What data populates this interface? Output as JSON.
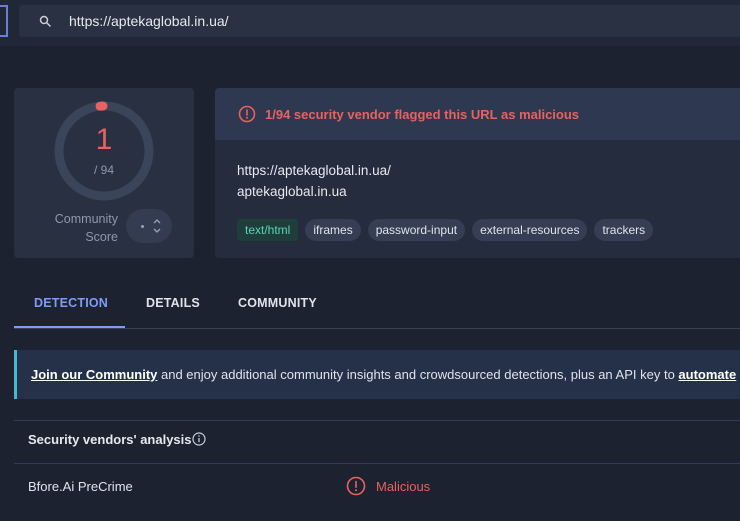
{
  "search": {
    "value": "https://aptekaglobal.in.ua/"
  },
  "score": {
    "malicious": "1",
    "total": "/ 94",
    "community_label_1": "Community",
    "community_label_2": "Score",
    "detection_fraction": 0.0106
  },
  "alert": {
    "text": "1/94 security vendor flagged this URL as malicious"
  },
  "target": {
    "url": "https://aptekaglobal.in.ua/",
    "domain": "aptekaglobal.in.ua"
  },
  "tags": [
    "text/html",
    "iframes",
    "password-input",
    "external-resources",
    "trackers"
  ],
  "tabs": [
    {
      "label": "DETECTION"
    },
    {
      "label": "DETAILS"
    },
    {
      "label": "COMMUNITY"
    }
  ],
  "banner": {
    "link": "Join our Community",
    "text": " and enjoy additional community insights and crowdsourced detections, plus an API key to ",
    "link2": "automate"
  },
  "vendors": {
    "header": "Security vendors' analysis",
    "rows": [
      {
        "vendor": "Bfore.Ai PreCrime",
        "verdict": "Malicious"
      }
    ]
  },
  "colors": {
    "accent": "#7f9cf5",
    "malicious": "#e8625f",
    "tag_green": "#5fd1b6"
  }
}
